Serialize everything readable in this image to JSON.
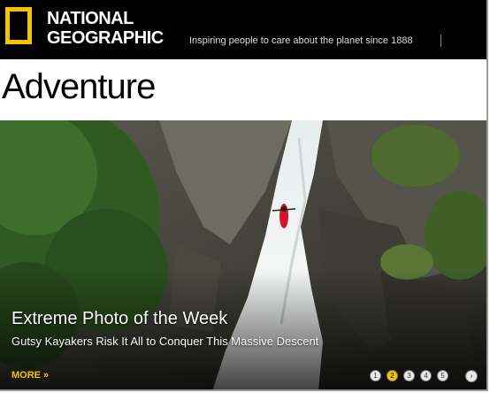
{
  "header": {
    "brand_line1": "NATIONAL",
    "brand_line2": "GEOGRAPHIC",
    "tagline": "Inspiring people to care about the planet since 1888",
    "logo_icon": "ng-yellow-border-icon",
    "colors": {
      "background": "#000000",
      "accent": "#f5c400"
    }
  },
  "page": {
    "title": "Adventure"
  },
  "hero": {
    "caption_title": "Extreme Photo of the Week",
    "caption_subtitle": "Gutsy Kayakers Risk It All to Conquer This Massive Descent",
    "more_label": "MORE »",
    "slides": [
      "1",
      "2",
      "3",
      "4",
      "5"
    ],
    "active_slide": 2,
    "next_label": "›"
  }
}
